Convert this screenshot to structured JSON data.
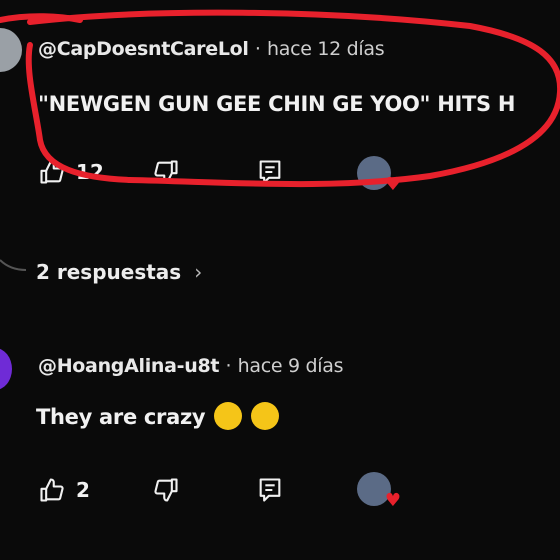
{
  "comments": [
    {
      "author": "@CapDoesntCareLol",
      "separator": "·",
      "time": "hace 12 días",
      "text": "\"NEWGEN GUN GEE CHIN GE YOO\" HITS H",
      "likes": "12"
    },
    {
      "author": "@HoangAlina-u8t",
      "separator": "·",
      "time": "hace 9 días",
      "text": "They are crazy",
      "likes": "2"
    }
  ],
  "replies": {
    "label": "2 respuestas",
    "chevron": "›"
  },
  "icons": {
    "like": "thumbs-up-icon",
    "dislike": "thumbs-down-icon",
    "reply": "comment-icon",
    "creator_heart": "heart-icon"
  },
  "colors": {
    "background": "#0a0a0a",
    "annotation": "#e8212c",
    "avatar_purple": "#6f2bd6",
    "heart": "#e8212c"
  }
}
